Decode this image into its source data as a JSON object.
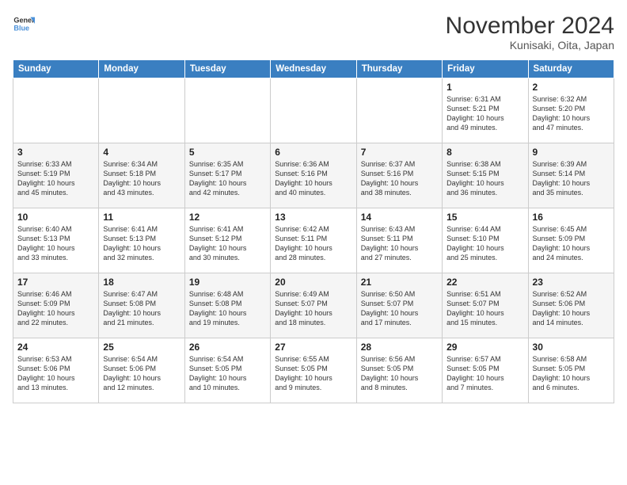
{
  "header": {
    "logo_line1": "General",
    "logo_line2": "Blue",
    "title": "November 2024",
    "subtitle": "Kunisaki, Oita, Japan"
  },
  "days_of_week": [
    "Sunday",
    "Monday",
    "Tuesday",
    "Wednesday",
    "Thursday",
    "Friday",
    "Saturday"
  ],
  "weeks": [
    [
      {
        "day": "",
        "info": ""
      },
      {
        "day": "",
        "info": ""
      },
      {
        "day": "",
        "info": ""
      },
      {
        "day": "",
        "info": ""
      },
      {
        "day": "",
        "info": ""
      },
      {
        "day": "1",
        "info": "Sunrise: 6:31 AM\nSunset: 5:21 PM\nDaylight: 10 hours\nand 49 minutes."
      },
      {
        "day": "2",
        "info": "Sunrise: 6:32 AM\nSunset: 5:20 PM\nDaylight: 10 hours\nand 47 minutes."
      }
    ],
    [
      {
        "day": "3",
        "info": "Sunrise: 6:33 AM\nSunset: 5:19 PM\nDaylight: 10 hours\nand 45 minutes."
      },
      {
        "day": "4",
        "info": "Sunrise: 6:34 AM\nSunset: 5:18 PM\nDaylight: 10 hours\nand 43 minutes."
      },
      {
        "day": "5",
        "info": "Sunrise: 6:35 AM\nSunset: 5:17 PM\nDaylight: 10 hours\nand 42 minutes."
      },
      {
        "day": "6",
        "info": "Sunrise: 6:36 AM\nSunset: 5:16 PM\nDaylight: 10 hours\nand 40 minutes."
      },
      {
        "day": "7",
        "info": "Sunrise: 6:37 AM\nSunset: 5:16 PM\nDaylight: 10 hours\nand 38 minutes."
      },
      {
        "day": "8",
        "info": "Sunrise: 6:38 AM\nSunset: 5:15 PM\nDaylight: 10 hours\nand 36 minutes."
      },
      {
        "day": "9",
        "info": "Sunrise: 6:39 AM\nSunset: 5:14 PM\nDaylight: 10 hours\nand 35 minutes."
      }
    ],
    [
      {
        "day": "10",
        "info": "Sunrise: 6:40 AM\nSunset: 5:13 PM\nDaylight: 10 hours\nand 33 minutes."
      },
      {
        "day": "11",
        "info": "Sunrise: 6:41 AM\nSunset: 5:13 PM\nDaylight: 10 hours\nand 32 minutes."
      },
      {
        "day": "12",
        "info": "Sunrise: 6:41 AM\nSunset: 5:12 PM\nDaylight: 10 hours\nand 30 minutes."
      },
      {
        "day": "13",
        "info": "Sunrise: 6:42 AM\nSunset: 5:11 PM\nDaylight: 10 hours\nand 28 minutes."
      },
      {
        "day": "14",
        "info": "Sunrise: 6:43 AM\nSunset: 5:11 PM\nDaylight: 10 hours\nand 27 minutes."
      },
      {
        "day": "15",
        "info": "Sunrise: 6:44 AM\nSunset: 5:10 PM\nDaylight: 10 hours\nand 25 minutes."
      },
      {
        "day": "16",
        "info": "Sunrise: 6:45 AM\nSunset: 5:09 PM\nDaylight: 10 hours\nand 24 minutes."
      }
    ],
    [
      {
        "day": "17",
        "info": "Sunrise: 6:46 AM\nSunset: 5:09 PM\nDaylight: 10 hours\nand 22 minutes."
      },
      {
        "day": "18",
        "info": "Sunrise: 6:47 AM\nSunset: 5:08 PM\nDaylight: 10 hours\nand 21 minutes."
      },
      {
        "day": "19",
        "info": "Sunrise: 6:48 AM\nSunset: 5:08 PM\nDaylight: 10 hours\nand 19 minutes."
      },
      {
        "day": "20",
        "info": "Sunrise: 6:49 AM\nSunset: 5:07 PM\nDaylight: 10 hours\nand 18 minutes."
      },
      {
        "day": "21",
        "info": "Sunrise: 6:50 AM\nSunset: 5:07 PM\nDaylight: 10 hours\nand 17 minutes."
      },
      {
        "day": "22",
        "info": "Sunrise: 6:51 AM\nSunset: 5:07 PM\nDaylight: 10 hours\nand 15 minutes."
      },
      {
        "day": "23",
        "info": "Sunrise: 6:52 AM\nSunset: 5:06 PM\nDaylight: 10 hours\nand 14 minutes."
      }
    ],
    [
      {
        "day": "24",
        "info": "Sunrise: 6:53 AM\nSunset: 5:06 PM\nDaylight: 10 hours\nand 13 minutes."
      },
      {
        "day": "25",
        "info": "Sunrise: 6:54 AM\nSunset: 5:06 PM\nDaylight: 10 hours\nand 12 minutes."
      },
      {
        "day": "26",
        "info": "Sunrise: 6:54 AM\nSunset: 5:05 PM\nDaylight: 10 hours\nand 10 minutes."
      },
      {
        "day": "27",
        "info": "Sunrise: 6:55 AM\nSunset: 5:05 PM\nDaylight: 10 hours\nand 9 minutes."
      },
      {
        "day": "28",
        "info": "Sunrise: 6:56 AM\nSunset: 5:05 PM\nDaylight: 10 hours\nand 8 minutes."
      },
      {
        "day": "29",
        "info": "Sunrise: 6:57 AM\nSunset: 5:05 PM\nDaylight: 10 hours\nand 7 minutes."
      },
      {
        "day": "30",
        "info": "Sunrise: 6:58 AM\nSunset: 5:05 PM\nDaylight: 10 hours\nand 6 minutes."
      }
    ]
  ]
}
